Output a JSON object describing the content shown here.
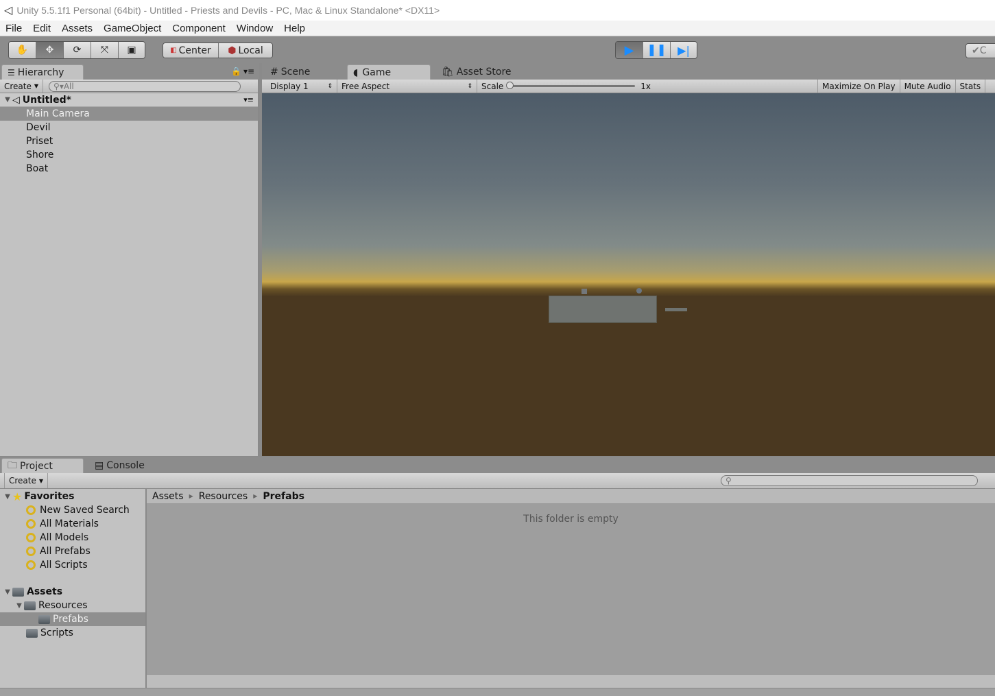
{
  "window": {
    "title": "Unity 5.5.1f1 Personal (64bit) - Untitled - Priests and Devils - PC, Mac & Linux Standalone* <DX11>",
    "logo": "unity-logo-icon"
  },
  "menu": [
    "File",
    "Edit",
    "Assets",
    "GameObject",
    "Component",
    "Window",
    "Help"
  ],
  "toolbar": {
    "tools": [
      "hand-icon",
      "move-icon",
      "rotate-icon",
      "scale-icon",
      "rect-icon"
    ],
    "active_tool": "move-icon",
    "pivot": "Center",
    "space": "Local",
    "play_active": true,
    "collab_label": "C"
  },
  "hierarchy": {
    "tab": "Hierarchy",
    "create": "Create",
    "search_placeholder": "All",
    "scene": "Untitled*",
    "items": [
      "Main Camera",
      "Devil",
      "Priset",
      "Shore",
      "Boat"
    ],
    "selected": "Main Camera"
  },
  "center_tabs": {
    "scene": "Scene",
    "game": "Game",
    "asset_store": "Asset Store"
  },
  "game": {
    "display": "Display 1",
    "aspect": "Free Aspect",
    "scale_label": "Scale",
    "scale_value": "1x",
    "maximize": "Maximize On Play",
    "mute": "Mute Audio",
    "stats": "Stats",
    "colors": {
      "sky_top": "#4d5b68",
      "horizon": "#c8a64a",
      "ground": "#4a3820",
      "object": "#6f7370"
    }
  },
  "bottom_tabs": {
    "project": "Project",
    "console": "Console"
  },
  "project": {
    "create": "Create",
    "favorites_label": "Favorites",
    "favorites": [
      "New Saved Search",
      "All Materials",
      "All Models",
      "All Prefabs",
      "All Scripts"
    ],
    "assets_label": "Assets",
    "assets": [
      {
        "name": "Resources",
        "level": 1,
        "expanded": true
      },
      {
        "name": "Prefabs",
        "level": 2,
        "selected": true
      },
      {
        "name": "Scripts",
        "level": 1
      }
    ],
    "breadcrumb": [
      "Assets",
      "Resources",
      "Prefabs"
    ],
    "empty_message": "This folder is empty"
  }
}
